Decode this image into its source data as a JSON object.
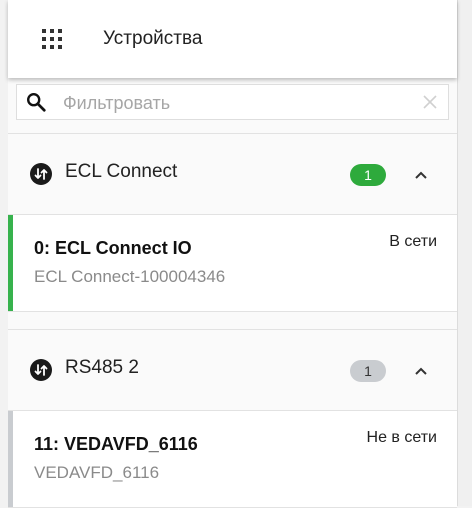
{
  "header": {
    "title": "Устройства"
  },
  "filter": {
    "placeholder": "Фильтровать",
    "value": ""
  },
  "groups": [
    {
      "label": "ECL Connect",
      "count": "1",
      "badge_color": "#2eaa3c",
      "devices": [
        {
          "name": "0: ECL Connect IO",
          "subtitle": "ECL Connect-100004346",
          "status": "В сети",
          "status_color": "#37b24d"
        }
      ]
    },
    {
      "label": "RS485 2",
      "count": "1",
      "badge_color": "#c9ccd0",
      "devices": [
        {
          "name": "11: VEDAVFD_6116",
          "subtitle": "VEDAVFD_6116",
          "status": "Не в сети",
          "status_color": "#c9ccd0"
        }
      ]
    }
  ]
}
